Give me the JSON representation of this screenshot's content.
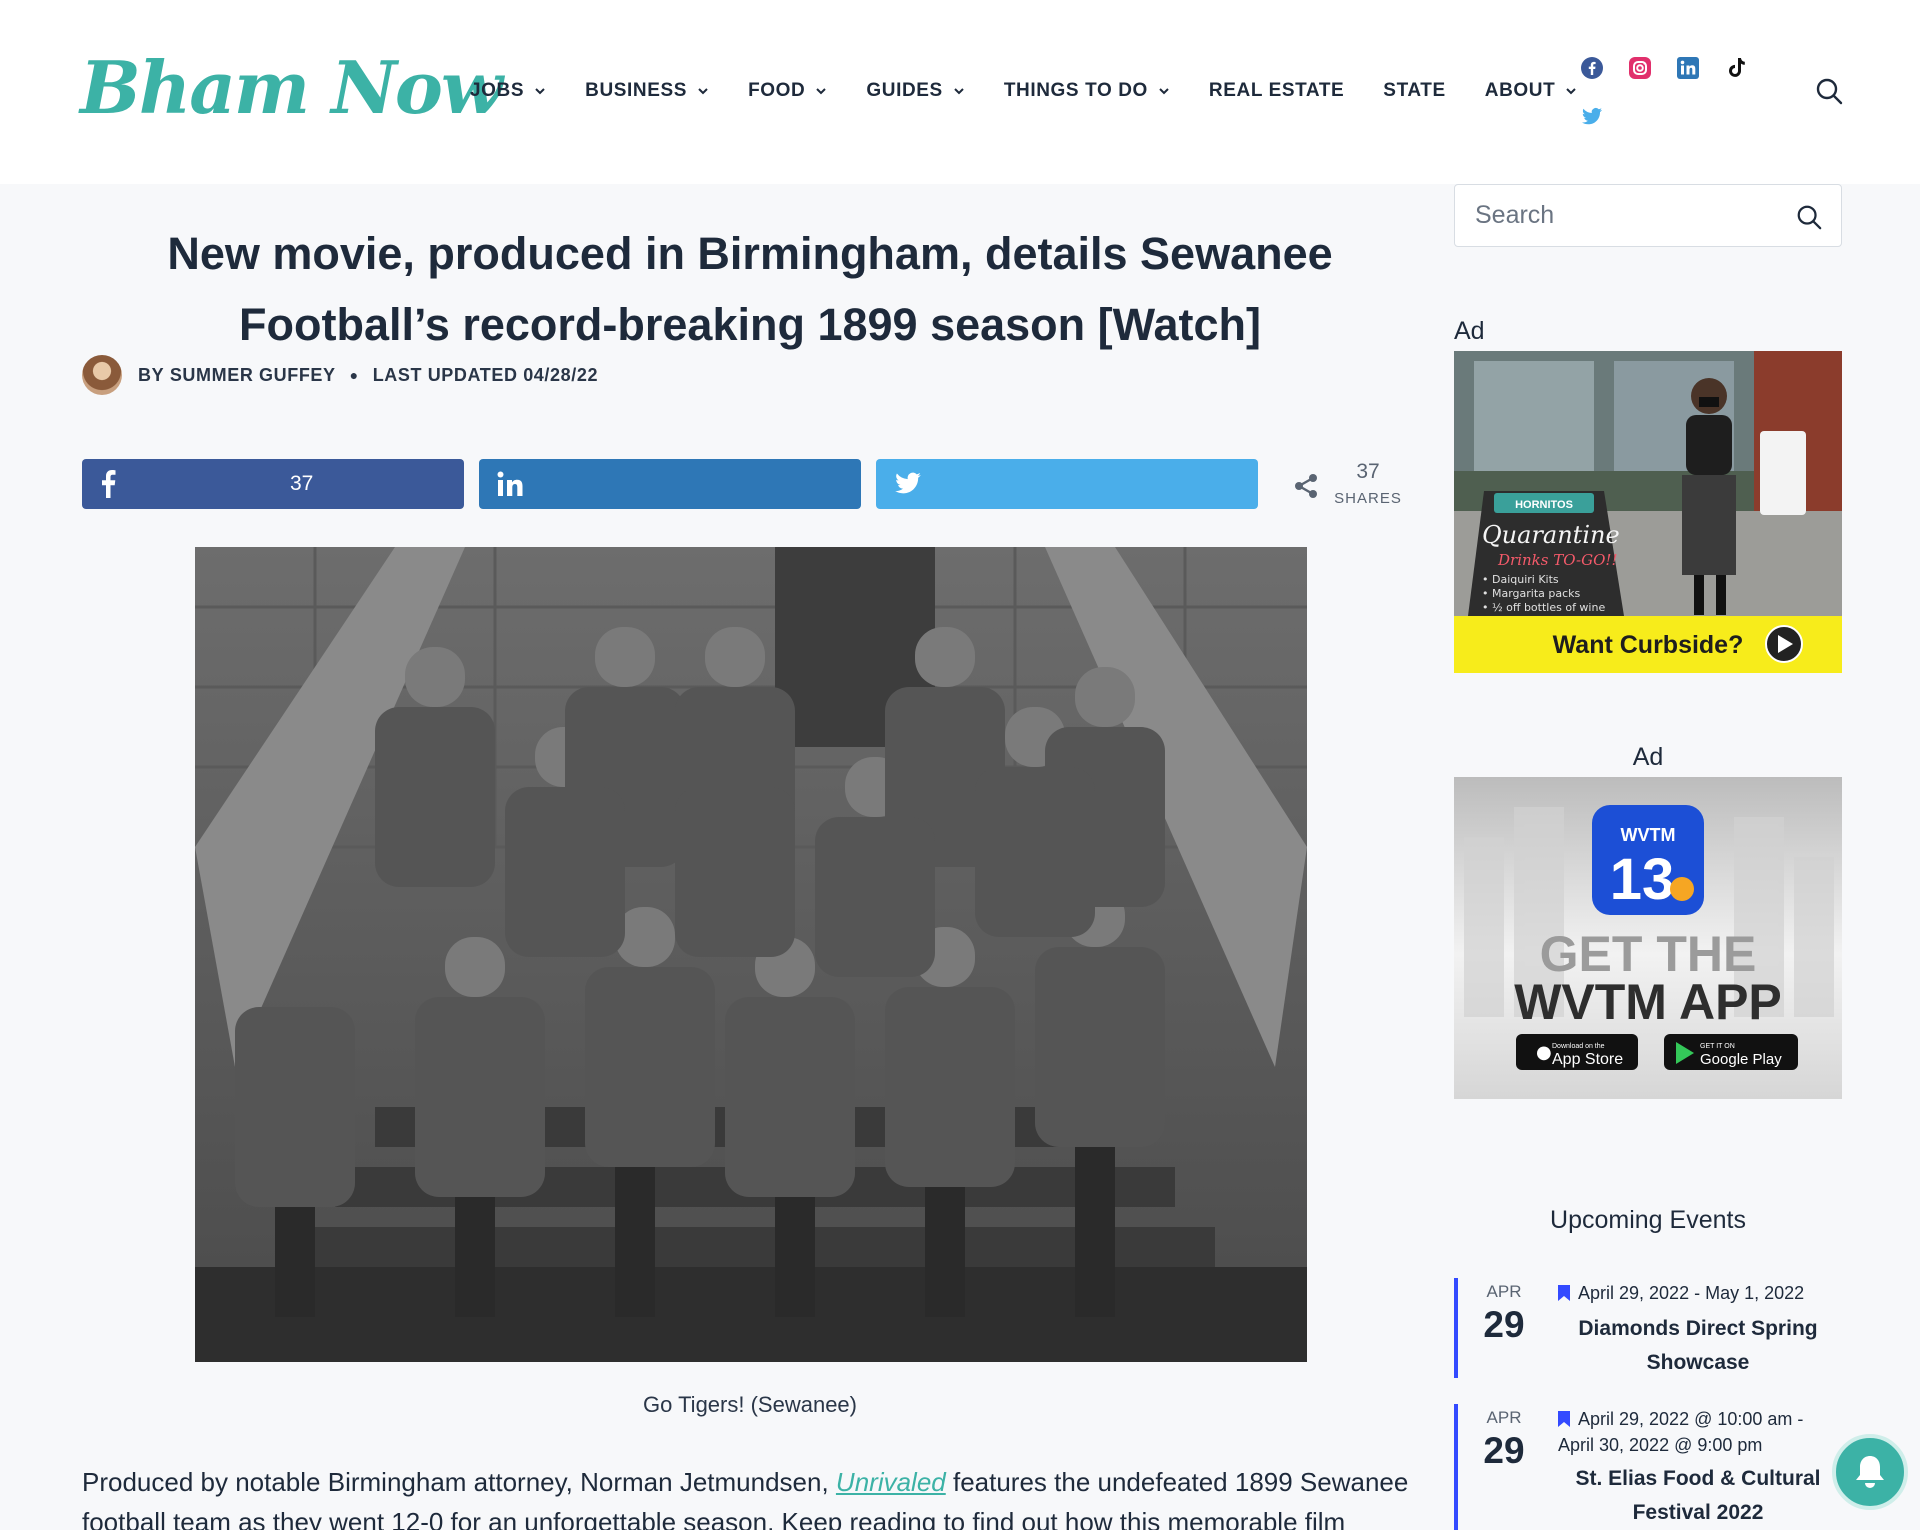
{
  "brand": {
    "logo_text": "Bham Now",
    "accent": "#3cb2a6"
  },
  "nav": {
    "items": [
      {
        "label": "JOBS",
        "dropdown": true
      },
      {
        "label": "BUSINESS",
        "dropdown": true
      },
      {
        "label": "FOOD",
        "dropdown": true
      },
      {
        "label": "GUIDES",
        "dropdown": true
      },
      {
        "label": "THINGS TO DO",
        "dropdown": true
      },
      {
        "label": "REAL ESTATE",
        "dropdown": false
      },
      {
        "label": "STATE",
        "dropdown": false
      },
      {
        "label": "ABOUT",
        "dropdown": true
      }
    ],
    "socials": [
      "facebook-icon",
      "instagram-icon",
      "linkedin-icon",
      "tiktok-icon",
      "twitter-icon"
    ]
  },
  "article": {
    "title": "New movie, produced in Birmingham, details Sewanee Football’s record-breaking 1899 season [Watch]",
    "byline": {
      "by_label": "BY",
      "author": "SUMMER GUFFEY",
      "updated_label": "LAST UPDATED",
      "updated_date": "04/28/22"
    },
    "share": {
      "facebook_count": "37",
      "total_count": "37",
      "total_label": "SHARES"
    },
    "image_caption": "Go Tigers! (Sewanee)",
    "body": {
      "part1": "Produced by notable Birmingham attorney, Norman Jetmundsen, ",
      "link": "Unrivaled",
      "part2": " features the undefeated 1899 Sewanee football team as they went 12-0 for an unforgettable season. Keep reading to find out how this memorable film"
    }
  },
  "sidebar": {
    "search_placeholder": "Search",
    "ad_label": "Ad",
    "ad1": {
      "sign_brand": "HORNITOS",
      "sign_title": "Quarantine",
      "sign_sub": "Drinks TO-GO!!",
      "sign_lines": [
        "• Daiquiri Kits",
        "• Margarita packs",
        "• ½ off bottles of wine"
      ],
      "cta": "Want Curbside?"
    },
    "ad2": {
      "badge_top": "WVTM",
      "badge_num": "13",
      "headline1": "GET THE",
      "headline2": "WVTM APP",
      "store1_small": "Download on the",
      "store1": "App Store",
      "store2_small": "GET IT ON",
      "store2": "Google Play"
    },
    "events_title": "Upcoming Events",
    "events": [
      {
        "month": "APR",
        "day": "29",
        "date": "April 29, 2022 - May 1, 2022",
        "title": "Diamonds Direct Spring Showcase"
      },
      {
        "month": "APR",
        "day": "29",
        "date": "April 29, 2022 @ 10:00 am - April 30, 2022 @ 9:00 pm",
        "title": "St. Elias Food & Cultural Festival 2022"
      }
    ]
  }
}
